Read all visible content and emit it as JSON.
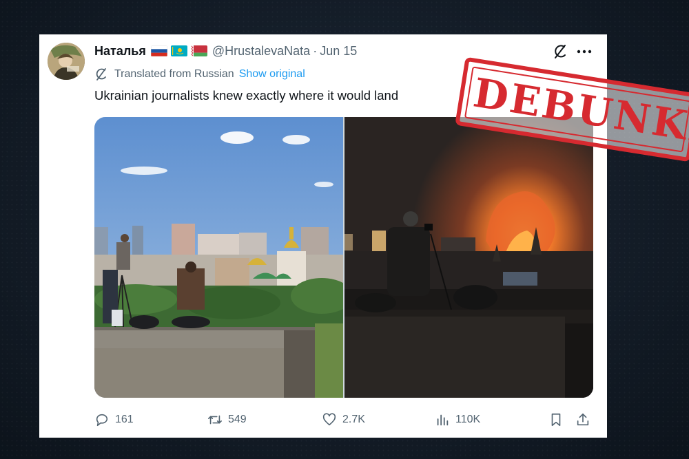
{
  "tweet": {
    "author_name": "Наталья",
    "handle": "@HrustalevaNata",
    "separator": "·",
    "date": "Jun 15",
    "translated_label": "Translated from Russian",
    "show_original_label": "Show original",
    "text": "Ukrainian journalists knew exactly where it would land",
    "flags": [
      "russia-flag",
      "kazakhstan-flag",
      "belarus-flag"
    ],
    "images": [
      {
        "description_icon": "daytime-rooftop-photo"
      },
      {
        "description_icon": "night-fire-rooftop-photo"
      }
    ]
  },
  "actions": {
    "replies": "161",
    "reposts": "549",
    "likes": "2.7K",
    "views": "110K"
  },
  "stamp": {
    "text": "DEBUNKED",
    "color": "#d62a30"
  },
  "colors": {
    "text_primary": "#0f1419",
    "text_secondary": "#536471",
    "link": "#1d9bf0"
  }
}
